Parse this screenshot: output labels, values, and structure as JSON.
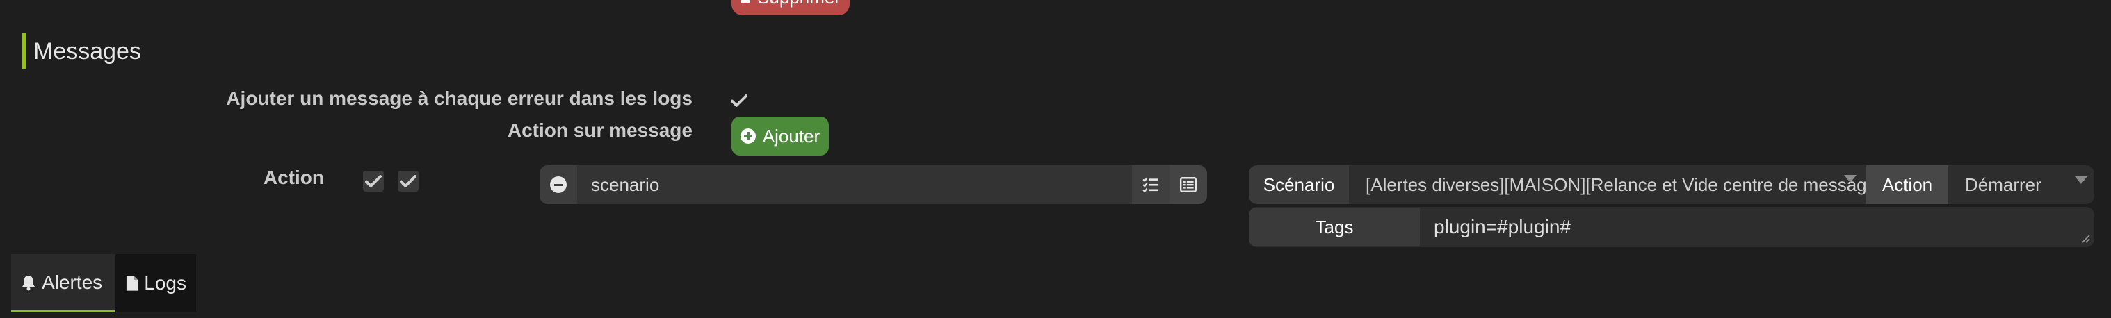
{
  "top": {
    "delete_label": "Supprimer"
  },
  "section": {
    "title": "Messages"
  },
  "options": {
    "error_label": "Ajouter un message à chaque erreur dans les logs",
    "action_label": "Action sur message",
    "add_label": "Ajouter"
  },
  "action_row": {
    "label": "Action",
    "command_value": "scenario"
  },
  "scenario": {
    "addon_label": "Scénario",
    "selected": "[Alertes diverses][MAISON][Relance et Vide centre de messages]",
    "action_label": "Action",
    "action_selected": "Démarrer",
    "tags_label": "Tags",
    "tags_value": "plugin=#plugin#"
  },
  "tabs": [
    {
      "label": "Alertes",
      "icon": "bell-icon"
    },
    {
      "label": "Logs",
      "icon": "file-icon"
    }
  ],
  "colors": {
    "accent": "#94c11f",
    "danger": "#b94a48",
    "success": "#4c8b3a"
  }
}
